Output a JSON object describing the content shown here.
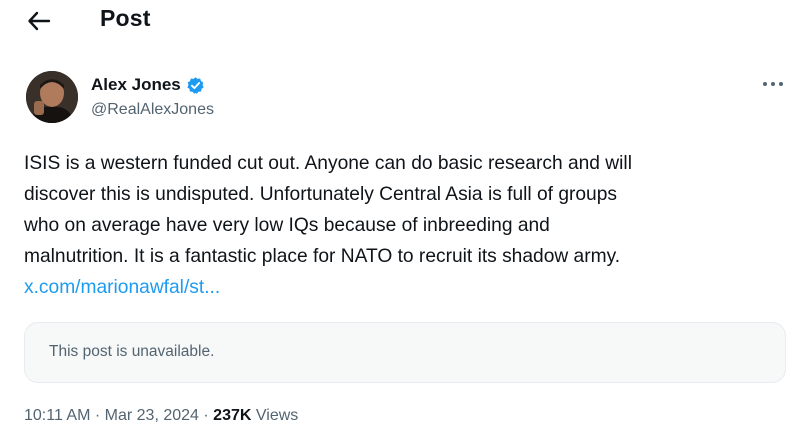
{
  "header": {
    "back_icon": "arrow-left-icon",
    "title": "Post"
  },
  "author": {
    "name": "Alex Jones",
    "handle": "@RealAlexJones",
    "verified_icon": "verified-badge-icon",
    "verified_color": "#1d9bf0"
  },
  "post": {
    "lines": [
      "ISIS is a western funded cut out. Anyone can do basic research and will",
      "discover this is undisputed. Unfortunately Central Asia is full of groups",
      "who on average have very low IQs because of inbreeding and",
      "malnutrition. It is a fantastic place for NATO to recruit its shadow army."
    ],
    "link_text": "x.com/marionawfal/st..."
  },
  "quoted": {
    "unavailable_text": "This post is unavailable."
  },
  "meta": {
    "time": "10:11 AM",
    "separator": "·",
    "date": "Mar 23, 2024",
    "views_count": "237K",
    "views_label": "Views"
  },
  "colors": {
    "text": "#0f1419",
    "secondary": "#536471",
    "link": "#1d9bf0",
    "card_bg": "#f7f9f9"
  }
}
